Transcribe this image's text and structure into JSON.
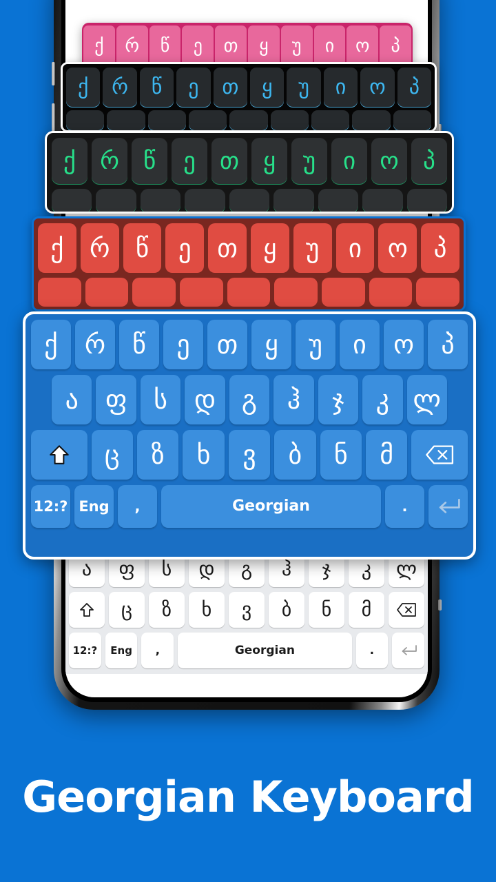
{
  "background_color": "#0a73d4",
  "title": {
    "text": "Georgian Keyboard"
  },
  "keyboards": {
    "pink": {
      "theme_name": "pink",
      "bg": "#c9246a",
      "key_bg": "#e8689c",
      "key_text": "#ffffff",
      "row1": [
        "ქ",
        "რ",
        "წ",
        "ე",
        "თ",
        "ყ",
        "უ",
        "ი",
        "ო",
        "პ"
      ]
    },
    "dark_cyan": {
      "theme_name": "dark-cyan",
      "bg": "#050505",
      "key_bg": "#262a2d",
      "key_text": "#3db7f0",
      "row1": [
        "ქ",
        "რ",
        "წ",
        "ე",
        "თ",
        "ყ",
        "უ",
        "ი",
        "ო",
        "პ"
      ],
      "row2": [
        "",
        "",
        "",
        "",
        "",
        "",
        "",
        "",
        ""
      ]
    },
    "dark_green": {
      "theme_name": "dark-green",
      "bg": "#151515",
      "key_bg": "#2e3133",
      "key_text": "#27e08a",
      "row1": [
        "ქ",
        "რ",
        "წ",
        "ე",
        "თ",
        "ყ",
        "უ",
        "ი",
        "ო",
        "პ"
      ],
      "row2": [
        "",
        "",
        "",
        "",
        "",
        "",
        "",
        "",
        ""
      ]
    },
    "red": {
      "theme_name": "red",
      "bg": "#7a2720",
      "key_bg": "#e04c42",
      "key_text": "#ffffff",
      "row1": [
        "ქ",
        "რ",
        "წ",
        "ე",
        "თ",
        "ყ",
        "უ",
        "ი",
        "ო",
        "პ"
      ],
      "row2": [
        "",
        "",
        "",
        "",
        "",
        "",
        "",
        "",
        ""
      ]
    },
    "blue": {
      "theme_name": "blue",
      "bg": "#1a6fc4",
      "key_bg": "#3b8fde",
      "key_text": "#ffffff",
      "border": "#ffffff",
      "row1": [
        "ქ",
        "რ",
        "წ",
        "ე",
        "თ",
        "ყ",
        "უ",
        "ი",
        "ო",
        "პ"
      ],
      "row2": [
        "ა",
        "ფ",
        "ს",
        "დ",
        "გ",
        "ჰ",
        "ჯ",
        "კ",
        "ლ"
      ],
      "row3_letters": [
        "ც",
        "ზ",
        "ხ",
        "ვ",
        "ბ",
        "ნ",
        "მ"
      ],
      "row3_shift_icon": "shift-icon",
      "row3_backspace_icon": "backspace-icon",
      "row4": {
        "symbols_label": "12:?",
        "language_toggle_label": "Eng",
        "comma_label": ",",
        "space_label": "Georgian",
        "period_label": ".",
        "enter_icon": "enter-icon"
      }
    },
    "white": {
      "theme_name": "white",
      "bg": "#e8eaed",
      "key_bg": "#ffffff",
      "key_text": "#1a1a1a",
      "row2": [
        "ა",
        "ფ",
        "ს",
        "დ",
        "გ",
        "ჰ",
        "ჯ",
        "კ",
        "ლ"
      ],
      "row3_letters": [
        "ც",
        "ზ",
        "ხ",
        "ვ",
        "ბ",
        "ნ",
        "მ"
      ],
      "row3_shift_icon": "shift-icon",
      "row3_backspace_icon": "backspace-icon",
      "row4": {
        "symbols_label": "12:?",
        "language_toggle_label": "Eng",
        "comma_label": ",",
        "space_label": "Georgian",
        "period_label": ".",
        "enter_icon": "enter-icon"
      }
    }
  }
}
